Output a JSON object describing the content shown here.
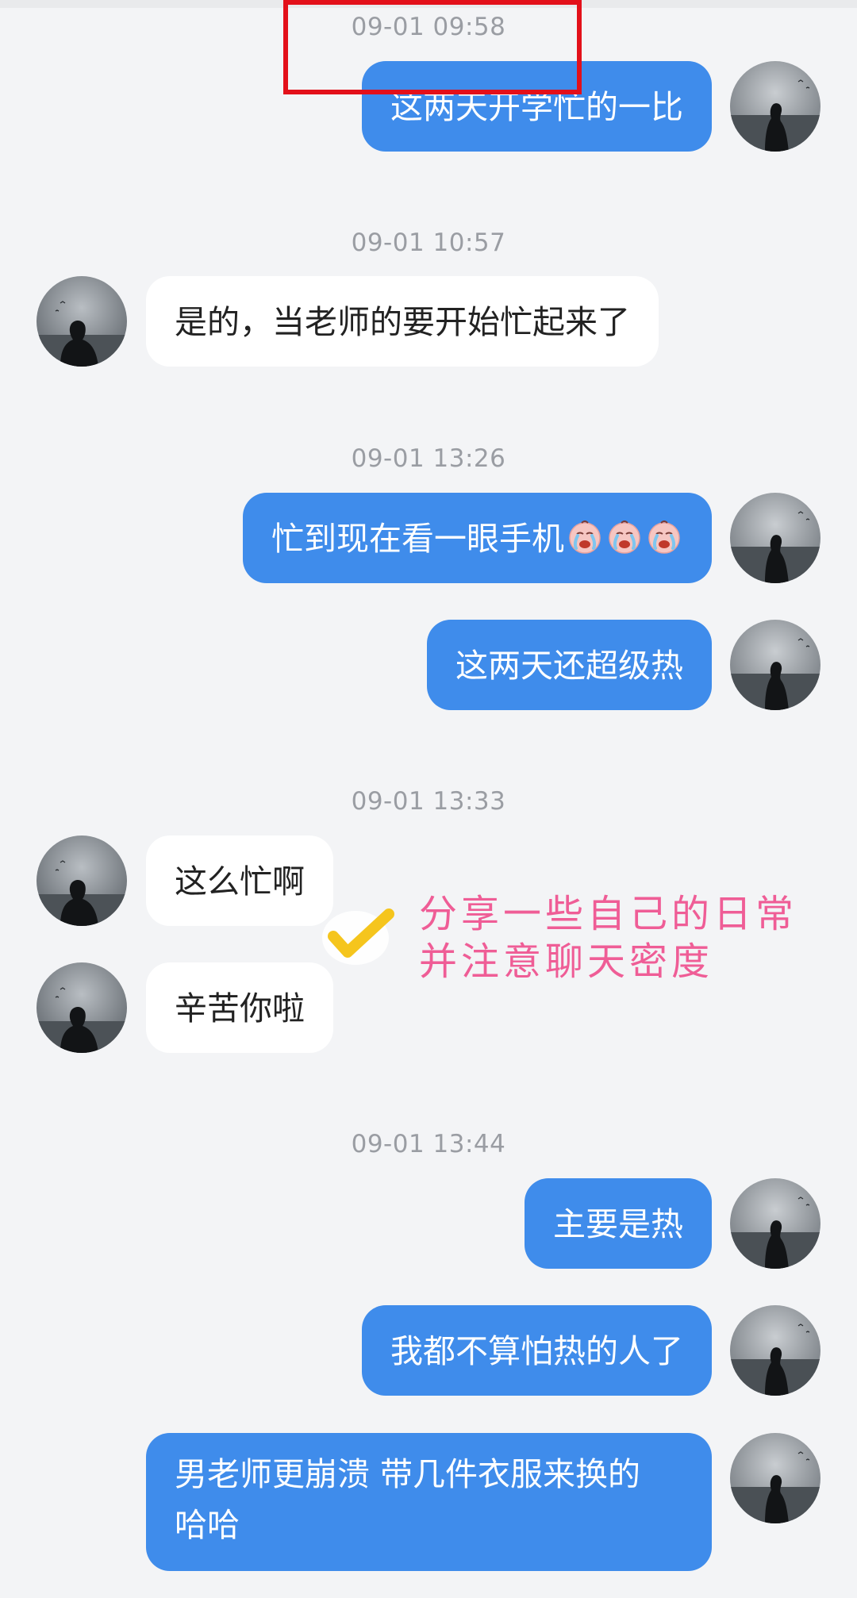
{
  "colors": {
    "my_bubble": "#3f8ceb",
    "their_bubble": "#ffffff",
    "annotation": "#ef5d96",
    "highlight_box": "#e3101a",
    "checkmark": "#f5c51d"
  },
  "timestamps": [
    "09-01 09:58",
    "09-01 10:57",
    "09-01 13:26",
    "09-01 13:33",
    "09-01 13:44"
  ],
  "messages": [
    {
      "sender": "me",
      "text": "这两天开学忙的一比"
    },
    {
      "sender": "them",
      "text": "是的，当老师的要开始忙起来了"
    },
    {
      "sender": "me",
      "text": "忙到现在看一眼手机",
      "emoji": [
        "crying-face-icon",
        "crying-face-icon",
        "crying-face-icon"
      ]
    },
    {
      "sender": "me",
      "text": "这两天还超级热"
    },
    {
      "sender": "them",
      "text": "这么忙啊"
    },
    {
      "sender": "them",
      "text": "辛苦你啦"
    },
    {
      "sender": "me",
      "text": "主要是热"
    },
    {
      "sender": "me",
      "text": "我都不算怕热的人了"
    },
    {
      "sender": "me",
      "text": "男老师更崩溃 带几件衣服来换的 哈哈"
    }
  ],
  "annotation": {
    "line1": "分享一些自己的日常",
    "line2": "并注意聊天密度"
  }
}
